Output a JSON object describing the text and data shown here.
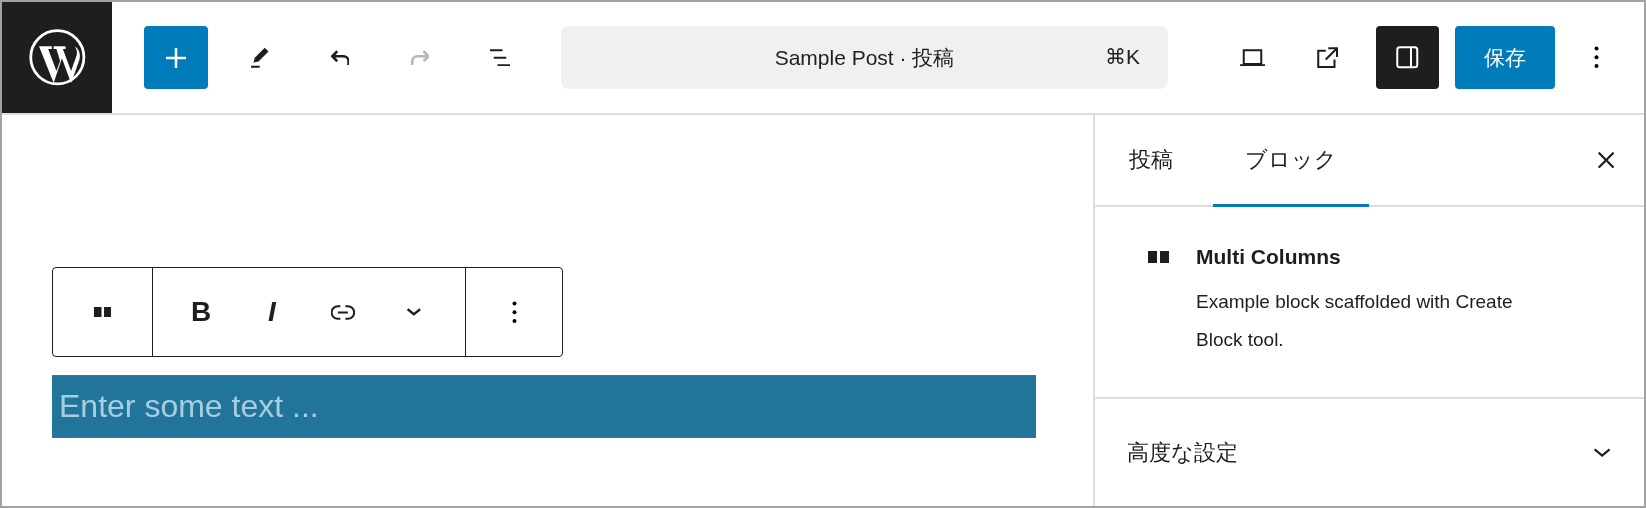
{
  "header": {
    "logo": {
      "kind": "wordpress"
    },
    "tools": [
      {
        "kind": "inserter"
      },
      {
        "kind": "tools"
      },
      {
        "kind": "undo",
        "disabled": false
      },
      {
        "kind": "redo",
        "disabled": true
      },
      {
        "kind": "outline"
      }
    ],
    "command_bar": {
      "title": "Sample Post · 投稿",
      "shortcut": "⌘K"
    },
    "actions": [
      {
        "kind": "preview",
        "pressed": false
      },
      {
        "kind": "view-post",
        "pressed": false
      },
      {
        "kind": "settings",
        "pressed": true
      }
    ],
    "save_button": "保存",
    "more": {
      "kind": "kebab"
    }
  },
  "editor": {
    "block_toolbar": {
      "groups": [
        [
          {
            "kind": "block-type"
          }
        ],
        [
          {
            "kind": "bold",
            "label": "B"
          },
          {
            "kind": "italic",
            "label": "I"
          },
          {
            "kind": "link"
          },
          {
            "kind": "more-options"
          }
        ],
        [
          {
            "kind": "kebab"
          }
        ]
      ]
    },
    "text_field": {
      "placeholder": "Enter some text ..."
    }
  },
  "sidebar": {
    "tabs": [
      {
        "label": "投稿",
        "selected": false
      },
      {
        "label": "ブロック",
        "selected": true
      }
    ],
    "block_card": {
      "title": "Multi Columns",
      "description": "Example block scaffolded with Create Block tool."
    },
    "panels": [
      {
        "title": "高度な設定",
        "expanded": false
      }
    ]
  }
}
